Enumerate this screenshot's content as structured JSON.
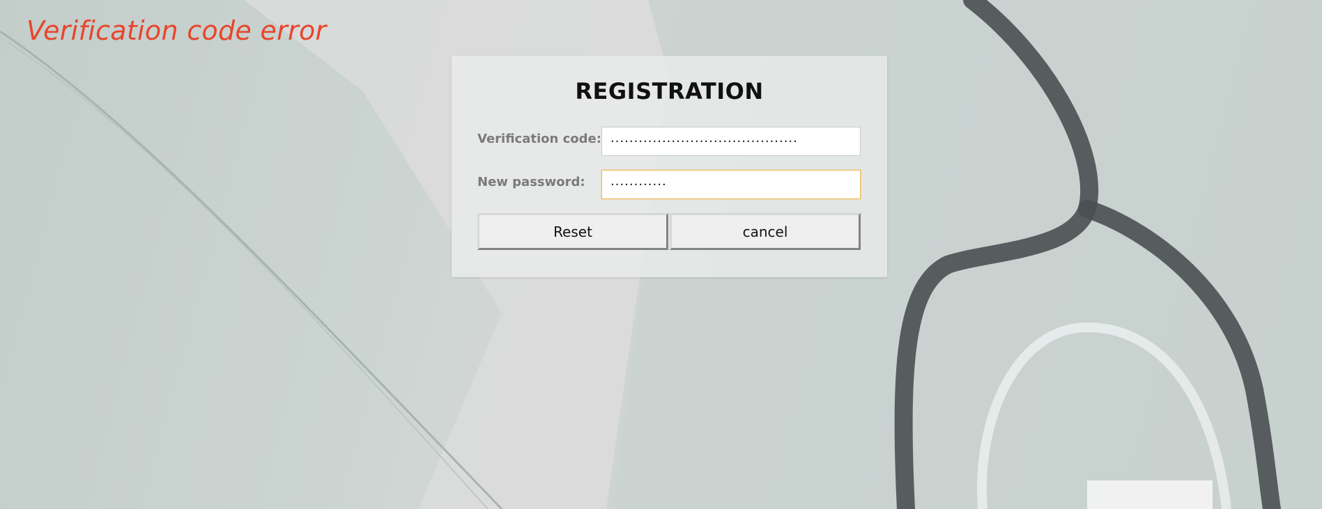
{
  "error": {
    "message": "Verification code error",
    "color": "#e8452c"
  },
  "form": {
    "title": "REGISTRATION",
    "verification_label": "Verification code:",
    "verification_value": "········································",
    "password_label": "New password:",
    "password_value": "············",
    "reset_label": "Reset",
    "cancel_label": "cancel"
  },
  "background": {
    "image": "doctor-coat-stethoscope"
  }
}
